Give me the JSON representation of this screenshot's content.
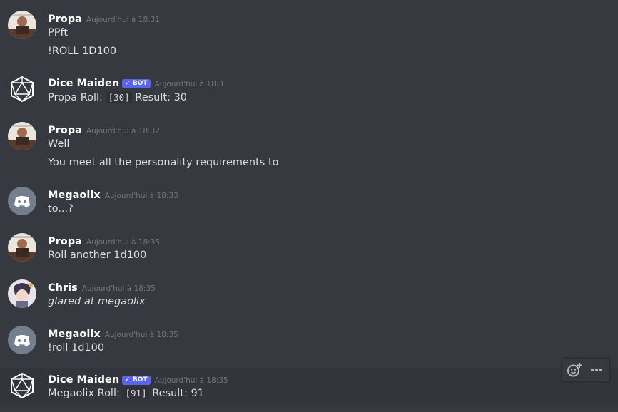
{
  "messages": [
    {
      "author": "Propa",
      "timestamp": "Aujourd'hui à 18:31",
      "lines": [
        "PPft",
        "!ROLL 1D100"
      ]
    },
    {
      "author": "Dice Maiden",
      "bot_tag": "BOT",
      "timestamp": "Aujourd'hui à 18:31",
      "roll": {
        "prefix": "Propa Roll:",
        "code": "[30]",
        "result": "Result: 30"
      }
    },
    {
      "author": "Propa",
      "timestamp": "Aujourd'hui à 18:32",
      "lines": [
        "Well",
        "You meet all the personality requirements to"
      ]
    },
    {
      "author": "Megaolix",
      "timestamp": "Aujourd'hui à 18:33",
      "lines": [
        "to...?"
      ]
    },
    {
      "author": "Propa",
      "timestamp": "Aujourd'hui à 18:35",
      "lines": [
        "Roll another 1d100"
      ]
    },
    {
      "author": "Chris",
      "timestamp": "Aujourd'hui à 18:35",
      "lines": [
        "glared at megaolix"
      ]
    },
    {
      "author": "Megaolix",
      "timestamp": "Aujourd'hui à 18:35",
      "lines": [
        "!roll 1d100"
      ]
    },
    {
      "author": "Dice Maiden",
      "bot_tag": "BOT",
      "timestamp": "Aujourd'hui à 18:35",
      "roll": {
        "prefix": "Megaolix Roll:",
        "code": "[91]",
        "result": "Result: 91"
      }
    }
  ],
  "colors": {
    "background": "#36393f",
    "bot_tag": "#5865f2",
    "discord_avatar": "#747f8d"
  },
  "icons": [
    "add-reaction-icon",
    "more-options-icon",
    "bot-check-icon"
  ]
}
